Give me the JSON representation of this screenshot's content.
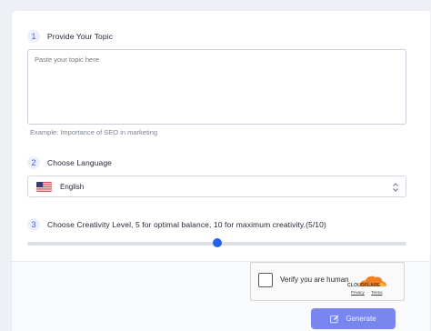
{
  "steps": [
    {
      "number": "1",
      "label": "Provide Your Topic"
    },
    {
      "number": "2",
      "label": "Choose Language"
    },
    {
      "number": "3",
      "label": "Choose Creativity Level, 5 for optimal balance, 10 for maximum creativity.(5/10)"
    }
  ],
  "topic": {
    "value": "",
    "placeholder": "Paste your topic here",
    "example": "Example:  Importance of SEO in marketing"
  },
  "language": {
    "selected": "English",
    "flag_icon": "us-flag-icon"
  },
  "creativity": {
    "value": 5,
    "min": 0,
    "max": 10
  },
  "captcha": {
    "label": "Verify you are human",
    "brand": "CLOUDFLARE",
    "privacy": "Privacy",
    "separator": "·",
    "terms": "Terms"
  },
  "generate": {
    "label": "Generate",
    "icon": "edit-icon"
  },
  "colors": {
    "accent": "#2563eb",
    "button": "#7a86f0",
    "cloudflare_orange": "#f38020"
  }
}
